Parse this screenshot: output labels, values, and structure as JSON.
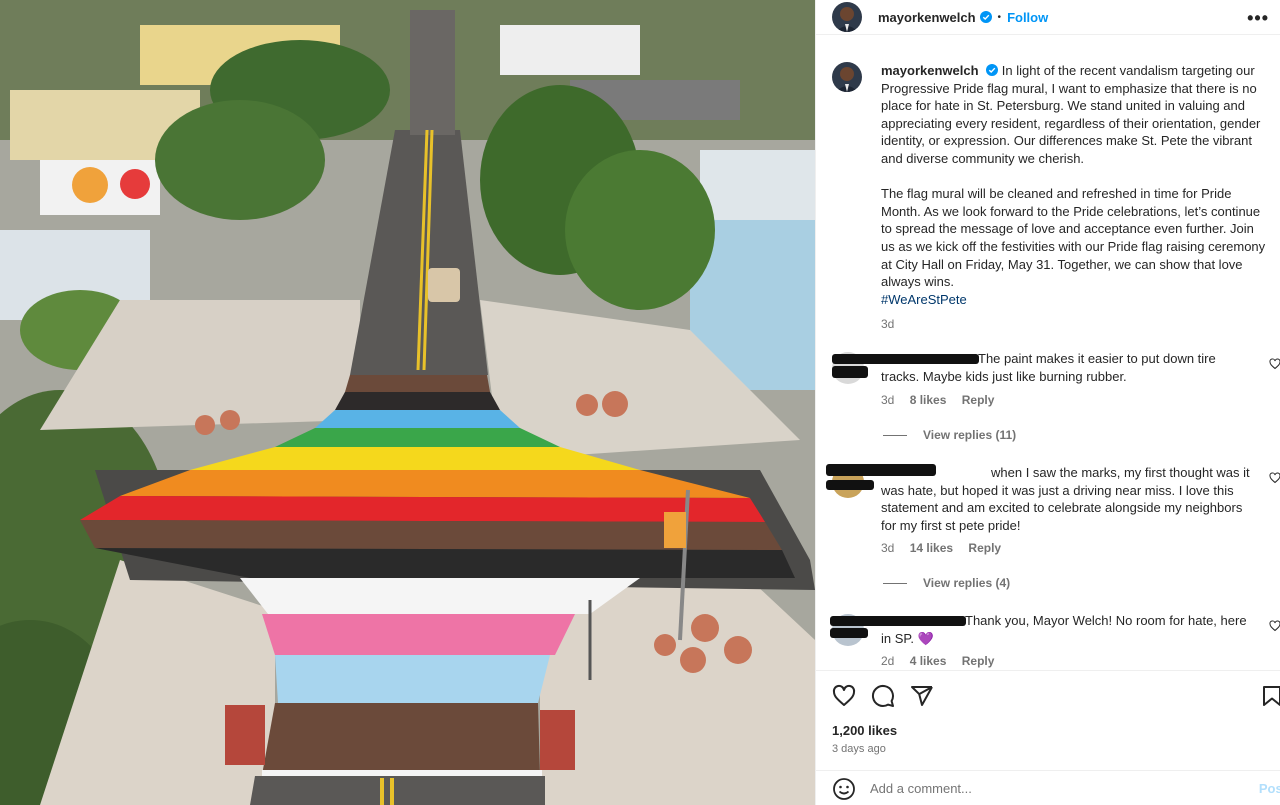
{
  "post": {
    "username": "mayorkenwelch",
    "follow_label": "Follow",
    "more_label": "•••",
    "caption_p1": "In light of the recent vandalism targeting our Progressive Pride flag mural, I want to emphasize that there is no place for hate in St. Petersburg. We stand united in valuing and appreciating every resident, regardless of their orientation, gender identity, or expression. Our differences make St. Pete the vibrant and diverse community we cherish.",
    "caption_p2": "The flag mural will be cleaned and refreshed in time for Pride Month. As we look forward to the Pride celebrations, let’s continue to spread the message of love and acceptance even further. Join us as we kick off the festivities with our Pride flag raising ceremony at City Hall on Friday, May 31. Together, we can show that love always wins.",
    "hashtag": "#WeAreStPete",
    "caption_time": "3d",
    "likes": "1,200 likes",
    "date": "3 days ago",
    "comment_placeholder": "Add a comment...",
    "post_label": "Post"
  },
  "comments": [
    {
      "text": "The paint makes it easier to put down tire tracks. Maybe kids just like burning rubber.",
      "time": "3d",
      "likes": "8 likes",
      "reply": "Reply",
      "view_replies": "View replies (11)"
    },
    {
      "text": "when I saw the marks, my first thought was it was hate, but hoped it was just a driving near miss. I love this statement and am excited to celebrate alongside my neighbors for my first st pete pride!",
      "time": "3d",
      "likes": "14 likes",
      "reply": "Reply",
      "view_replies": "View replies (4)"
    },
    {
      "text": "Thank you, Mayor Welch! No room for hate, here in SP. 💜",
      "time": "2d",
      "likes": "4 likes",
      "reply": "Reply"
    }
  ],
  "colors": {
    "link": "#0095f6",
    "hashtag": "#00376b",
    "muted": "#737373",
    "flag": [
      "#6b4a3a",
      "#2d2a2a",
      "#59b3e6",
      "#3aa64a",
      "#f5d81c",
      "#f08b1f",
      "#e3262b",
      "#6b4a3a",
      "#2a2a2a",
      "#f5f5f5",
      "#ee74a6",
      "#a8d5ee",
      "#6b4a3a"
    ]
  },
  "icons": [
    "heart-icon",
    "comment-icon",
    "share-icon",
    "bookmark-icon",
    "emoji-icon",
    "verified-badge-icon",
    "more-options-icon"
  ]
}
